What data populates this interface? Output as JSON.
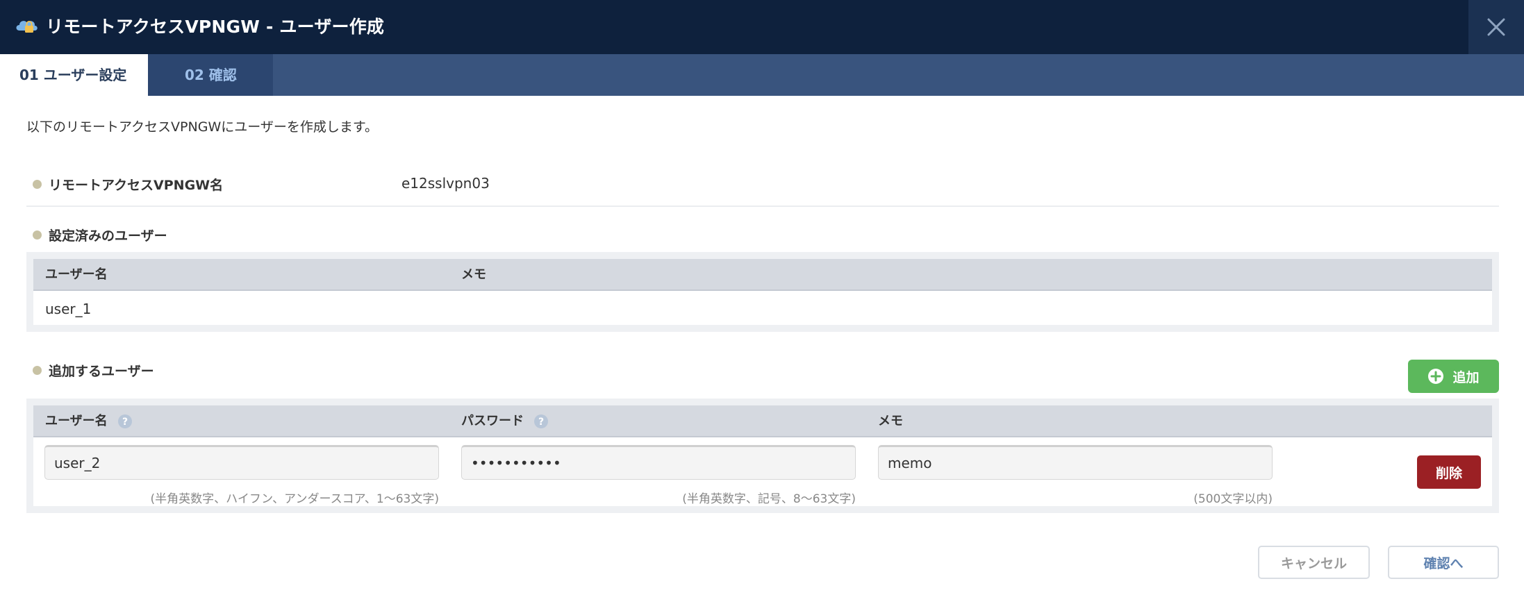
{
  "window": {
    "title": "リモートアクセスVPNGW - ユーザー作成",
    "logo_icon": "cloud-lock-icon",
    "close_icon": "close-icon"
  },
  "tabs": [
    {
      "label": "01 ユーザー設定",
      "active": true
    },
    {
      "label": "02 確認",
      "active": false
    }
  ],
  "intro": "以下のリモートアクセスVPNGWにユーザーを作成します。",
  "vpngw": {
    "label": "リモートアクセスVPNGW名",
    "value": "e12sslvpn03"
  },
  "existing_users": {
    "label": "設定済みのユーザー",
    "columns": [
      "ユーザー名",
      "メモ"
    ],
    "rows": [
      {
        "username": "user_1",
        "memo": ""
      }
    ]
  },
  "add_users": {
    "label": "追加するユーザー",
    "add_button": "追加",
    "columns": {
      "username": "ユーザー名",
      "password": "パスワード",
      "memo": "メモ"
    },
    "rows": [
      {
        "username": "user_2",
        "password": "•••••••••••",
        "memo": "memo",
        "delete_button": "削除"
      }
    ],
    "hints": {
      "username": "(半角英数字、ハイフン、アンダースコア、1〜63文字)",
      "password": "(半角英数字、記号、8〜63文字)",
      "memo": "(500文字以内)"
    }
  },
  "footer": {
    "cancel": "キャンセル",
    "next": "確認へ"
  },
  "colors": {
    "header_bg": "#0e213d",
    "tabbar_bg": "#39547e",
    "add_green": "#5cb85c",
    "delete_red": "#9b2024"
  }
}
